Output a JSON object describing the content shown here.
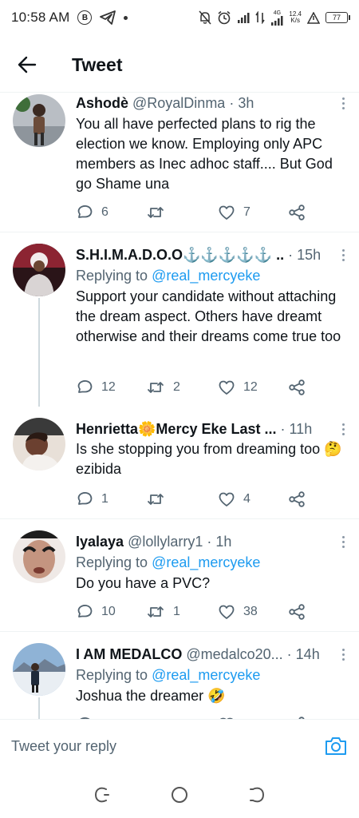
{
  "status_bar": {
    "time": "10:58 AM",
    "badge_letter": "B",
    "net_type": "4G",
    "speed_value": "12.4",
    "speed_unit": "K/s",
    "battery": "77",
    "icons": [
      "b-badge-icon",
      "telegram-icon",
      "dot-icon",
      "mute-icon",
      "alarm-icon",
      "signal-icon",
      "data-arrows-icon",
      "signal-icon",
      "alert-icon",
      "battery-icon"
    ]
  },
  "header": {
    "title": "Tweet",
    "back_icon": "arrow-left-icon"
  },
  "replies": [
    {
      "name": "Ashodè",
      "handle": "@RoyalDinma",
      "time": "· 3h",
      "replying_prefix": "",
      "replying_to": "",
      "text": "You all have perfected plans to rig the election we know. Employing only APC members as Inec adhoc staff.... But God go Shame una",
      "replies": "6",
      "retweets": "",
      "likes": "7",
      "avatar_color": "#9aa1a8"
    },
    {
      "name": "S.H.I.M.A.D.O.O⚓⚓⚓⚓⚓ ..",
      "handle": "",
      "time": "· 15h",
      "replying_prefix": "Replying to",
      "replying_to": "@real_mercyeke",
      "text": "Support your candidate without attaching the dream aspect. Others have dreamt otherwise and their dreams come true too",
      "replies": "12",
      "retweets": "2",
      "likes": "12",
      "avatar_color": "#7a2430"
    },
    {
      "name": "Henrietta🌼Mercy Eke Last ...",
      "handle": "",
      "time": "· 11h",
      "replying_prefix": "",
      "replying_to": "",
      "text": "Is she stopping you from dreaming too 🤔 ezibida",
      "replies": "1",
      "retweets": "",
      "likes": "4",
      "avatar_color": "#c9a58a"
    },
    {
      "name": "Iyalaya",
      "handle": "@lollylarry1",
      "time": "· 1h",
      "replying_prefix": "Replying to",
      "replying_to": "@real_mercyeke",
      "text": "Do you have a PVC?",
      "replies": "10",
      "retweets": "1",
      "likes": "38",
      "avatar_color": "#b98a78"
    },
    {
      "name": "I AM MEDALCO",
      "handle": "@medalco20...",
      "time": "· 14h",
      "replying_prefix": "Replying to",
      "replying_to": "@real_mercyeke",
      "text": "Joshua the dreamer 🤣",
      "replies": "",
      "retweets": "",
      "likes": "",
      "avatar_color": "#8fb3d6"
    }
  ],
  "composer": {
    "placeholder": "Tweet your reply",
    "camera_icon": "camera-icon"
  },
  "nav_bar": {
    "icons": [
      "recents-icon",
      "home-icon",
      "back-icon"
    ]
  },
  "colors": {
    "accent": "#1d9bf0",
    "secondary_text": "#536471",
    "thread_line": "#cfd9de"
  }
}
